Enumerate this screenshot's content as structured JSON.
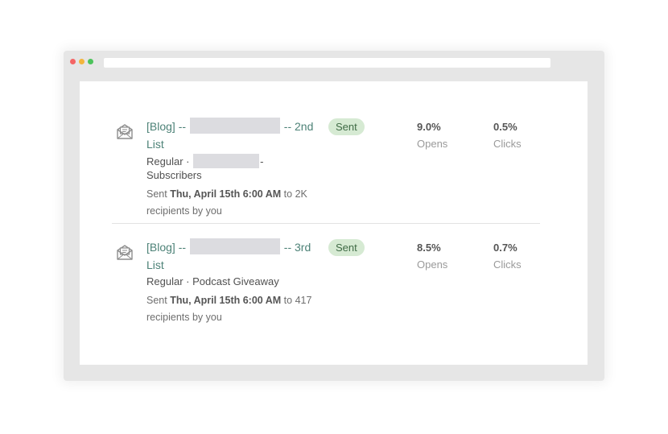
{
  "colors": {
    "dot_red": "#f46464",
    "dot_yellow": "#f3b53c",
    "dot_green": "#4cc35b",
    "link": "#4d8277",
    "badge_bg": "#d6ead3"
  },
  "campaigns": [
    {
      "icon": "envelope-open-icon",
      "title_prefix": "[Blog] --",
      "title_suffix": "-- 2nd",
      "title_line2": "List",
      "meta_prefix": "Regular ·",
      "meta_suffix": "- Subscribers",
      "sent_prefix": "Sent",
      "sent_date": "Thu, April 15th 6:00 AM",
      "sent_rest": "to 2K",
      "sent_line2": "recipients by you",
      "status": "Sent",
      "opens_value": "9.0%",
      "opens_label": "Opens",
      "clicks_value": "0.5%",
      "clicks_label": "Clicks"
    },
    {
      "icon": "envelope-open-icon",
      "title_prefix": "[Blog] --",
      "title_suffix": "-- 3rd",
      "title_line2": "List",
      "meta_text": "Regular · Podcast Giveaway",
      "sent_prefix": "Sent",
      "sent_date": "Thu, April 15th 6:00 AM",
      "sent_rest": "to 417",
      "sent_line2": "recipients by you",
      "status": "Sent",
      "opens_value": "8.5%",
      "opens_label": "Opens",
      "clicks_value": "0.7%",
      "clicks_label": "Clicks"
    }
  ]
}
